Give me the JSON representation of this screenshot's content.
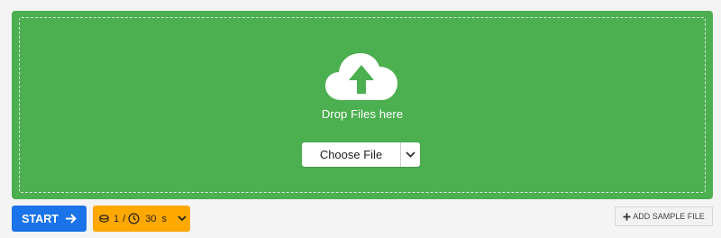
{
  "dropzone": {
    "text": "Drop Files here",
    "choose_label": "Choose File",
    "icons": [
      "cloud-upload-icon",
      "chevron-down-icon"
    ]
  },
  "toolbar": {
    "start_label": "START",
    "count_value": "1",
    "separator": "/",
    "time_value": "30",
    "time_unit": "s",
    "sample_label": "ADD SAMPLE FILE",
    "icons": [
      "arrow-right-icon",
      "stack-icon",
      "clock-icon",
      "chevron-down-icon",
      "plus-icon"
    ]
  },
  "colors": {
    "dropzone_bg": "#4caf50",
    "start_bg": "#1a73e8",
    "options_bg": "#ffa800",
    "page_bg": "#f4f4f4"
  }
}
